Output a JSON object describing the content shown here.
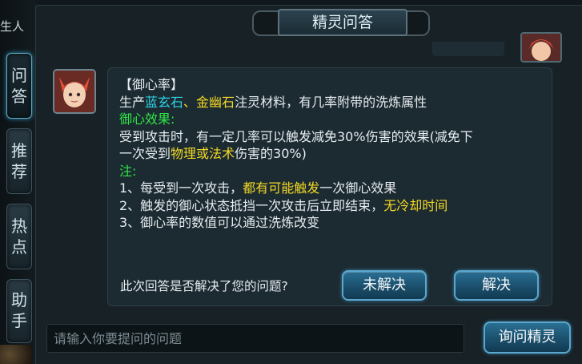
{
  "window": {
    "title": "精灵问答"
  },
  "left_rail": {
    "top_text": "生人"
  },
  "side_tabs": [
    {
      "label_line1": "问",
      "label_line2": "答"
    },
    {
      "label_line1": "推",
      "label_line2": "荐"
    },
    {
      "label_line1": "热",
      "label_line2": "点"
    },
    {
      "label_line1": "助",
      "label_line2": "手"
    }
  ],
  "message": {
    "title": "【御心率】",
    "line2_prefix": "生产",
    "line2_item1": "蓝玄石",
    "line2_sep": "、",
    "line2_item2": "金幽石",
    "line2_suffix": "注灵材料，有几率附带的洗炼属性",
    "effect_heading": "御心效果:",
    "effect_line1": "受到攻击时，有一定几率可以触发减免30%伤害的效果(减免下",
    "effect_line2_prefix": "一次受到",
    "effect_line2_highlight": "物理或法术",
    "effect_line2_suffix": "伤害的30%)",
    "note_heading": "注:",
    "note1_prefix": "1、每受到一次攻击，",
    "note1_highlight": "都有可能触发",
    "note1_suffix": "一次御心效果",
    "note2_prefix": "2、触发的御心状态抵挡一次攻击后立即结束，",
    "note2_highlight": "无冷却时间",
    "note3": "3、御心率的数值可以通过洗炼改变"
  },
  "feedback": {
    "question": "此次回答是否解决了您的问题?",
    "unsolved_label": "未解决",
    "solved_label": "解决"
  },
  "input": {
    "placeholder": "请输入你要提问的问题",
    "value": ""
  },
  "ask_button": {
    "label": "询问精灵"
  },
  "colors": {
    "green": "#2ee646",
    "yellow": "#f4d824",
    "cyan": "#2ed4e8",
    "button_blue": "#1b4f6c"
  }
}
